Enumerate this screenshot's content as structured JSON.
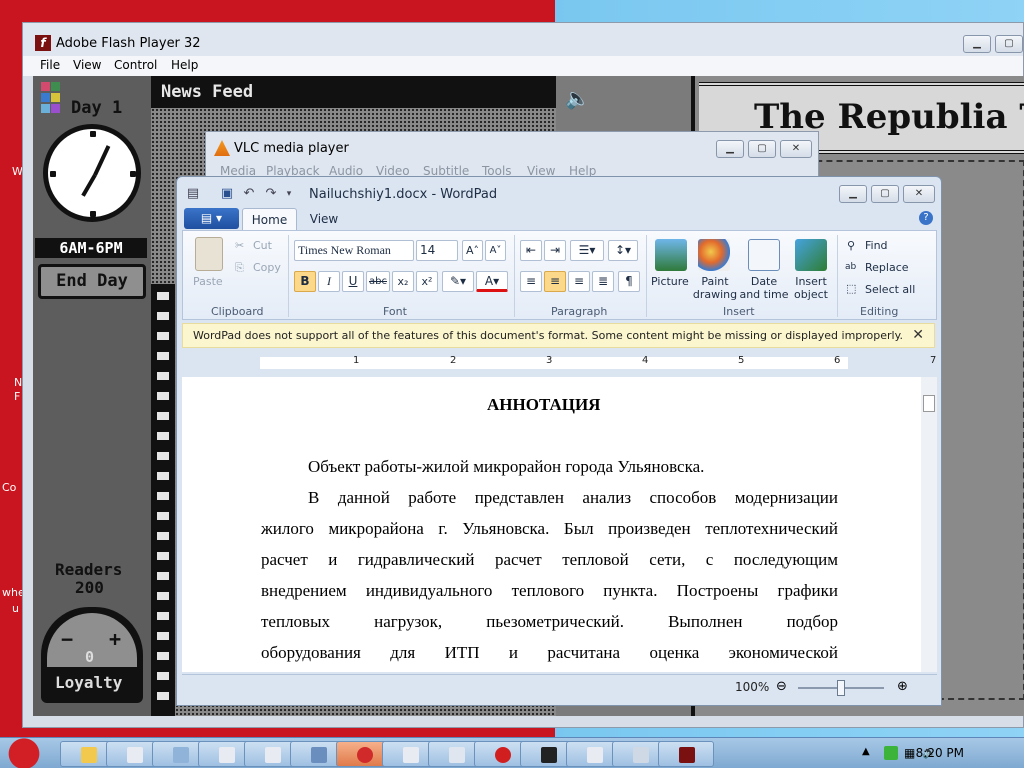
{
  "flash": {
    "title": "Adobe Flash Player 32",
    "menu": [
      "File",
      "View",
      "Control",
      "Help"
    ]
  },
  "game": {
    "day": "Day 1",
    "time_range": "6AM-6PM",
    "end_day": "End Day",
    "news_feed": "News Feed",
    "newspaper_title": "The Republia Times",
    "readers_label": "Readers",
    "readers_value": "200",
    "loyalty_value": "0",
    "loyalty_label": "Loyalty",
    "gauge_minus": "−",
    "gauge_plus": "+"
  },
  "vlc": {
    "title": "VLC media player",
    "menu": [
      "Media",
      "Playback",
      "Audio",
      "Video",
      "Subtitle",
      "Tools",
      "View",
      "Help"
    ]
  },
  "wordpad": {
    "title": "Nailuchshiy1.docx - WordPad",
    "tabs": {
      "home": "Home",
      "view": "View"
    },
    "clipboard": {
      "paste": "Paste",
      "cut": "Cut",
      "copy": "Copy",
      "label": "Clipboard"
    },
    "font": {
      "name": "Times New Roman",
      "size": "14",
      "label": "Font",
      "bold": "B",
      "italic": "I",
      "underline": "U",
      "strike": "abc",
      "sub": "x₂",
      "sup": "x²"
    },
    "paragraph": {
      "label": "Paragraph"
    },
    "insert": {
      "picture": "Picture",
      "paint": "Paint drawing",
      "datetime": "Date and time",
      "object": "Insert object",
      "label": "Insert"
    },
    "editing": {
      "find": "Find",
      "replace": "Replace",
      "select_all": "Select all",
      "label": "Editing"
    },
    "infobar": "WordPad does not support all of the features of this document's format. Some content might be missing or displayed improperly.",
    "ruler_numbers": [
      "1",
      "2",
      "3",
      "4",
      "5",
      "6",
      "7"
    ],
    "document": {
      "heading": "АННОТАЦИЯ",
      "lines": [
        "Объект работы-жилой микрорайон города Ульяновска.",
        "В данной работе представлен анализ способов модернизации",
        "жилого микрорайона г. Ульяновска. Был произведен теплотехнический",
        "расчет и гидравлический расчет тепловой сети, с последующим",
        "внедрением индивидуального теплового пункта. Построены графики",
        "тепловых нагрузок, пьезометрический. Выполнен подбор",
        "оборудования для ИТП и расчитана оценка экономической"
      ]
    },
    "zoom": "100%"
  },
  "taskbar": {
    "clock": "8:20 PM"
  },
  "desktop": {
    "labels": [
      "W",
      "N",
      "F",
      "Co",
      "whe",
      "u"
    ]
  }
}
